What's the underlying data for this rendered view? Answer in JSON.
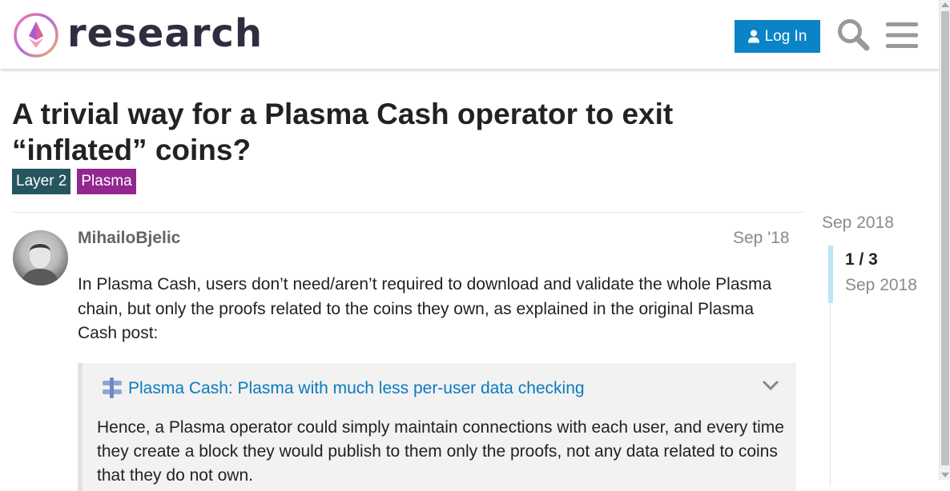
{
  "header": {
    "logo_text": "research",
    "login_label": "Log In",
    "icons": [
      "logo-icon",
      "user-icon",
      "search-icon",
      "hamburger-menu-icon"
    ]
  },
  "topic": {
    "title": "A trivial way for a Plasma Cash operator to exit “inflated” coins?",
    "tags": [
      {
        "label": "Layer 2",
        "color": "#25565f"
      },
      {
        "label": "Plasma",
        "color": "#92278f"
      }
    ]
  },
  "post": {
    "username": "MihailoBjelic",
    "date": "Sep '18",
    "body": "In Plasma Cash, users don’t need/aren’t required to download and validate the whole Plasma chain, but only the proofs related to the coins they own, as explained in the original Plasma Cash post:",
    "onebox": {
      "link_text": "Plasma Cash: Plasma with much less per-user data checking",
      "quote": "Hence, a Plasma operator could simply maintain connections with each user, and every time they create a block they would publish to them only the proofs, not any data related to coins that they do not own."
    }
  },
  "timeline": {
    "start_date": "Sep 2018",
    "position": "1 / 3",
    "current_date": "Sep 2018"
  },
  "colors": {
    "accent": "#0a84c6",
    "link": "#0a7abf",
    "timeline_handle": "#bde3f5"
  }
}
